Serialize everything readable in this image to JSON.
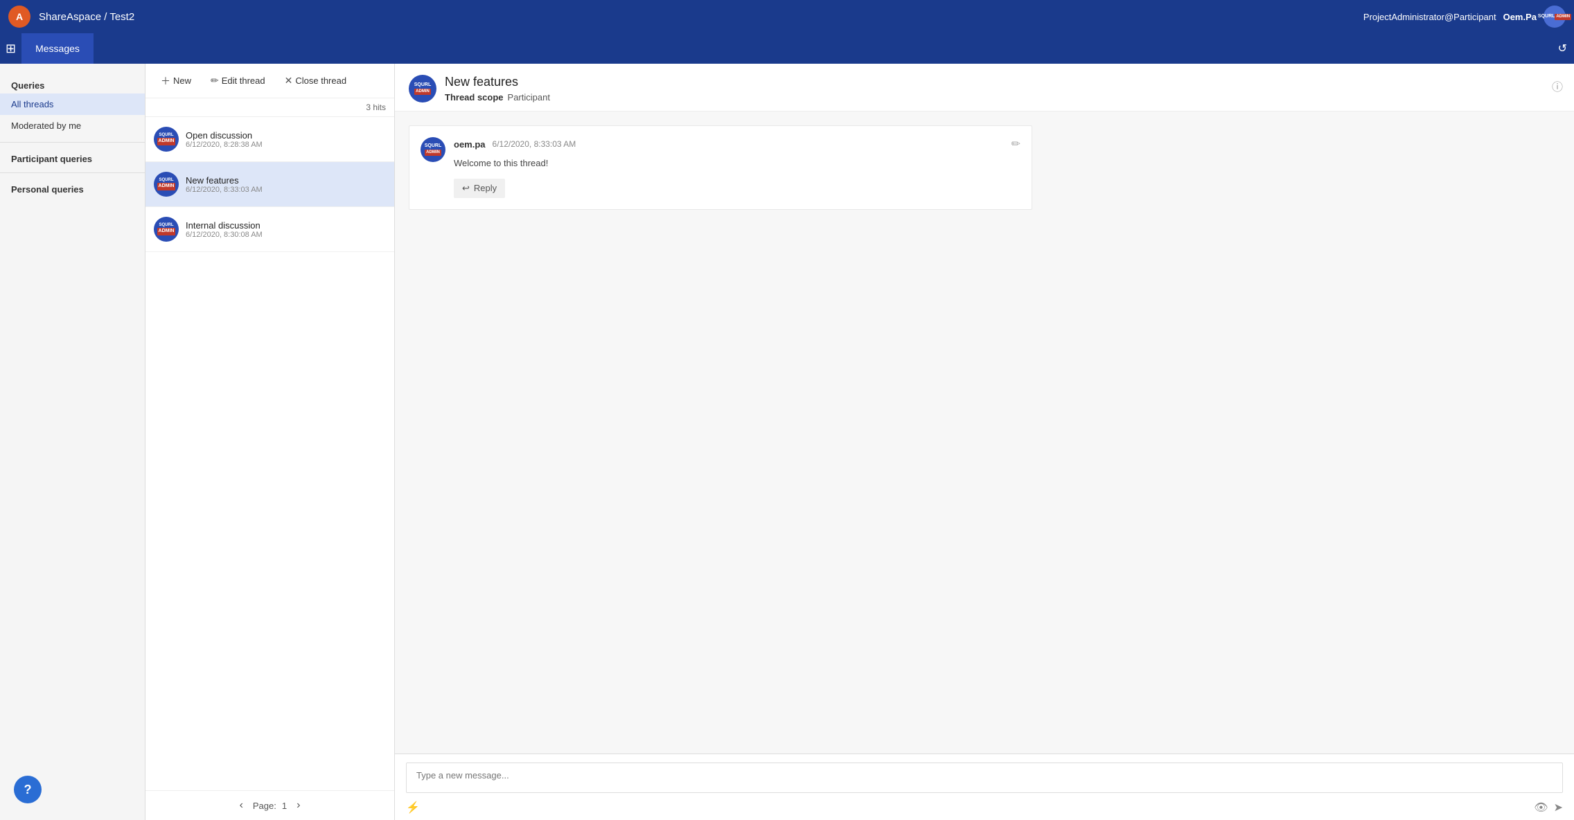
{
  "topbar": {
    "logo_text": "A",
    "app_name": "ShareAspace",
    "separator": "/",
    "project_name": "Test2",
    "user_email": "ProjectAdministrator@Participant",
    "user_name": "Oem.Pa",
    "user_avatar_line1": "SQURL",
    "user_avatar_line2": "ADMIN"
  },
  "secondbar": {
    "tab_label": "Messages"
  },
  "sidebar": {
    "queries_label": "Queries",
    "items": [
      {
        "label": "All threads",
        "active": true
      },
      {
        "label": "Moderated by me",
        "active": false
      }
    ],
    "participant_queries_label": "Participant queries",
    "personal_queries_label": "Personal queries"
  },
  "toolbar": {
    "new_label": "New",
    "edit_label": "Edit thread",
    "close_label": "Close thread"
  },
  "thread_list": {
    "hits": "3 hits",
    "threads": [
      {
        "name": "Open discussion",
        "date": "6/12/2020, 8:28:38 AM",
        "active": false,
        "avatar_line1": "SQURL",
        "avatar_line2": "ADMIN"
      },
      {
        "name": "New features",
        "date": "6/12/2020, 8:33:03 AM",
        "active": true,
        "avatar_line1": "SQURL",
        "avatar_line2": "ADMIN"
      },
      {
        "name": "Internal discussion",
        "date": "6/12/2020, 8:30:08 AM",
        "active": false,
        "avatar_line1": "SQURL",
        "avatar_line2": "ADMIN"
      }
    ],
    "pagination": {
      "page_label": "Page:",
      "page_number": "1"
    }
  },
  "thread_detail": {
    "title": "New features",
    "avatar_line1": "SQURL",
    "avatar_line2": "ADMIN",
    "scope_label": "Thread scope",
    "scope_value": "Participant",
    "messages": [
      {
        "author": "oem.pa",
        "time": "6/12/2020, 8:33:03 AM",
        "text": "Welcome to this thread!",
        "reply_label": "Reply",
        "avatar_line1": "SQURL",
        "avatar_line2": "ADMIN"
      }
    ]
  },
  "compose": {
    "placeholder": "Type a new message..."
  },
  "help": {
    "label": "?"
  }
}
